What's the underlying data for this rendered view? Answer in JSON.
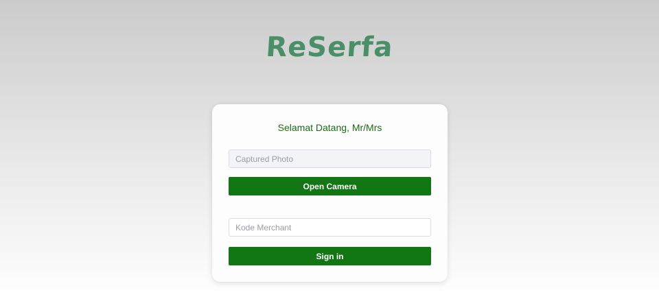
{
  "app": {
    "logo_text": "ReSerfa"
  },
  "login": {
    "greeting": "Selamat Datang, Mr/Mrs",
    "photo_placeholder": "Captured Photo",
    "open_camera_label": "Open Camera",
    "merchant_placeholder": "Kode Merchant",
    "signin_label": "Sign in"
  },
  "colors": {
    "logo": "#4a8f68",
    "primary_button": "#127614",
    "greeting_text": "#1a6b14"
  }
}
